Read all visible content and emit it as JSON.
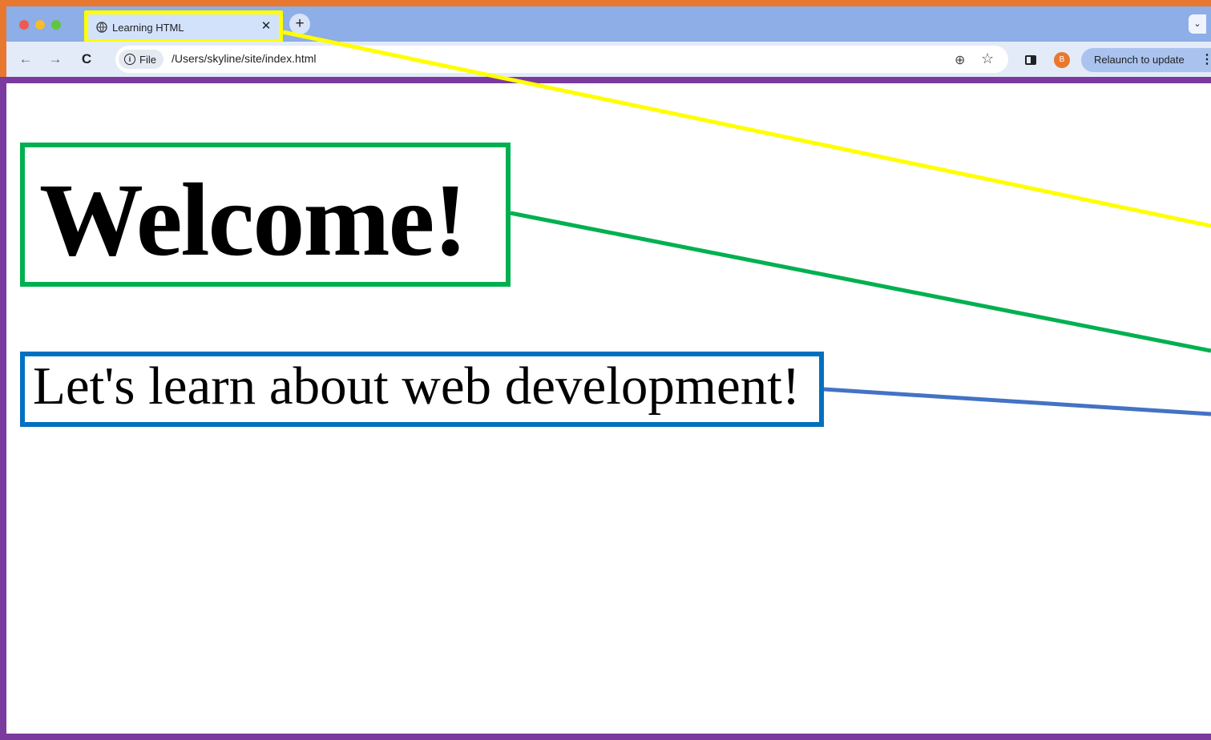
{
  "browser": {
    "tab": {
      "title": "Learning HTML",
      "close_glyph": "✕",
      "icon": "globe-icon"
    },
    "new_tab_glyph": "+",
    "tab_menu_glyph": "⌄",
    "nav": {
      "back": "←",
      "forward": "→",
      "reload": "C"
    },
    "address": {
      "chip_label": "File",
      "url": "/Users/skyline/site/index.html"
    },
    "zoom_icon": "⊕",
    "bookmark_icon": "☆",
    "profile_initial": "B",
    "relaunch_label": "Relaunch to update",
    "menu_glyph": "⋮"
  },
  "page": {
    "heading": "Welcome!",
    "paragraph": "Let's learn about web development!"
  },
  "colors": {
    "chrome_outline": "#e8782f",
    "tab_highlight": "#ffff00",
    "heading_box": "#00b050",
    "paragraph_box": "#0070c0",
    "viewport_border": "#7a3a9e"
  }
}
